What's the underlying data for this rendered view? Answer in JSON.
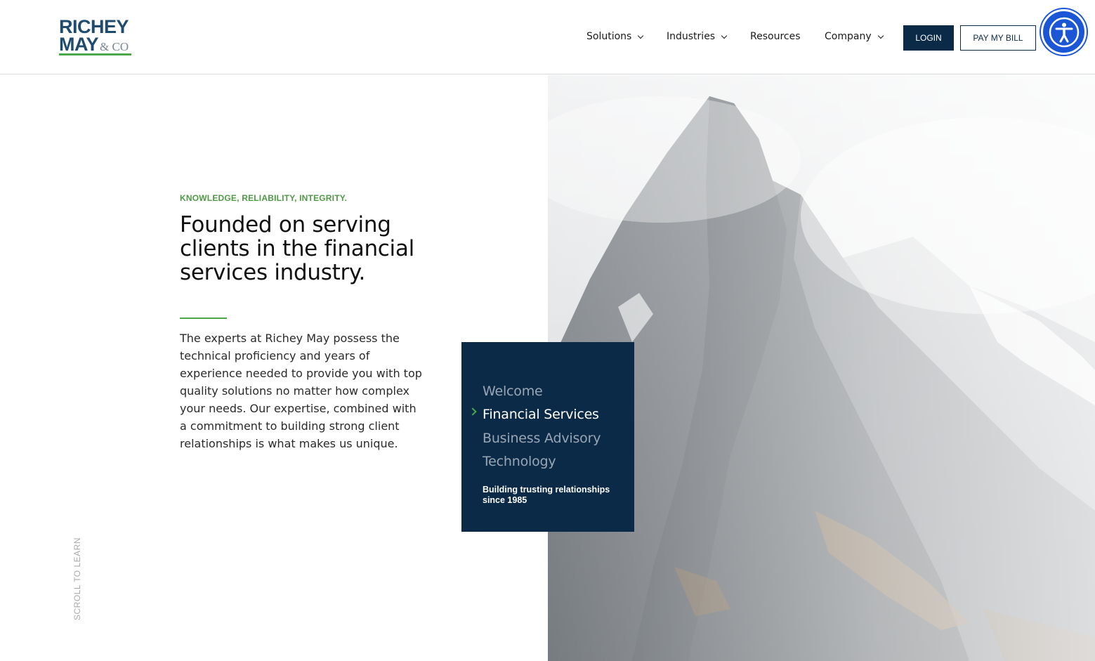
{
  "brand": {
    "logo_line1": "RICHEY",
    "logo_line2": "MAY",
    "logo_suffix": "& CO",
    "primary_color": "#0b2a48",
    "accent_color": "#4aa84a"
  },
  "nav": {
    "items": [
      {
        "label": "Solutions",
        "has_dropdown": true
      },
      {
        "label": "Industries",
        "has_dropdown": true
      },
      {
        "label": "Resources",
        "has_dropdown": false
      },
      {
        "label": "Company",
        "has_dropdown": true
      }
    ],
    "login_label": "LOGIN",
    "pay_label": "PAY MY BILL",
    "accessibility_icon": "accessibility-person-icon"
  },
  "hero": {
    "eyebrow": "KNOWLEDGE, RELIABILITY, INTEGRITY.",
    "headline": "Founded on serving clients in the financial services industry.",
    "body": "The experts at Richey May possess the technical proficiency and years of experience needed to provide you with top quality solutions no matter how complex your needs. Our expertise, combined with a commitment to building strong client relationships is what makes us unique.",
    "scroll_hint": "SCROLL TO LEARN"
  },
  "card": {
    "items": [
      {
        "label": "Welcome",
        "active": false
      },
      {
        "label": "Financial Services",
        "active": true
      },
      {
        "label": "Business Advisory",
        "active": false
      },
      {
        "label": "Technology",
        "active": false
      }
    ],
    "tagline": "Building trusting relationships since 1985"
  }
}
